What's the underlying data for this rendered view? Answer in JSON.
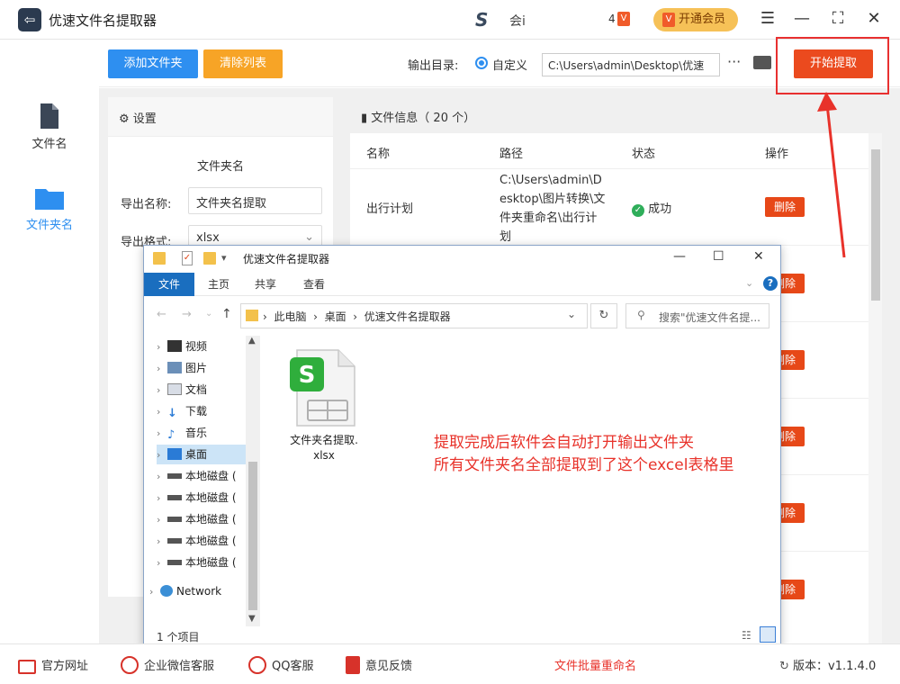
{
  "app": {
    "title": "优速文件名提取器",
    "user_name": "会i",
    "vip_count": "4",
    "vip_icon_glyph": "V",
    "vip_label": "开通会员"
  },
  "window_controls": {
    "menu": "☰",
    "minimize": "—",
    "maximize": "⛶",
    "close": "✕"
  },
  "sidebar": {
    "items": [
      {
        "label": "文件名",
        "icon": "file-icon"
      },
      {
        "label": "文件夹名",
        "icon": "folder-icon"
      }
    ]
  },
  "toolbar": {
    "add_folder": "添加文件夹",
    "clear_list": "清除列表",
    "output_label": "输出目录:",
    "custom_label": "自定义",
    "output_path": "C:\\Users\\admin\\Desktop\\优速",
    "more": "···",
    "start": "开始提取"
  },
  "settings": {
    "header": "设置",
    "subtitle": "文件夹名",
    "export_name_label": "导出名称:",
    "export_name_value": "文件夹名提取",
    "export_format_label": "导出格式:",
    "export_format_value": "xlsx"
  },
  "fileinfo": {
    "header": "文件信息（ 20 个）",
    "columns": [
      "名称",
      "路径",
      "状态",
      "操作"
    ],
    "rows": [
      {
        "name": "出行计划",
        "path": "C:\\Users\\admin\\Desktop\\图片转换\\文件夹重命名\\出行计划",
        "status": "成功",
        "action": "删除"
      }
    ],
    "delete_label": "删除"
  },
  "explorer": {
    "title": "优速文件名提取器",
    "ribbon_tabs": [
      "文件",
      "主页",
      "共享",
      "查看"
    ],
    "breadcrumb": [
      "此电脑",
      "桌面",
      "优速文件名提取器"
    ],
    "search_placeholder": "搜索\"优速文件名提...",
    "nav_items": [
      "视频",
      "图片",
      "文档",
      "下载",
      "音乐",
      "桌面",
      "本地磁盘 (",
      "本地磁盘 (",
      "本地磁盘 (",
      "本地磁盘 (",
      "本地磁盘 (",
      "Network"
    ],
    "file_name": "文件夹名提取.xlsx",
    "status": "1 个项目"
  },
  "annotation": {
    "line1": "提取完成后软件会自动打开输出文件夹",
    "line2": "所有文件夹名全部提取到了这个excel表格里"
  },
  "bottombar": {
    "website": "官方网址",
    "wechat": "企业微信客服",
    "qq": "QQ客服",
    "feedback": "意见反馈",
    "rename": "文件批量重命名",
    "version": "版本：v1.1.4.0"
  },
  "colors": {
    "accent_blue": "#2e8ff0",
    "accent_orange": "#f7a426",
    "accent_red": "#eb4a1e",
    "annotation_red": "#e8322a"
  }
}
